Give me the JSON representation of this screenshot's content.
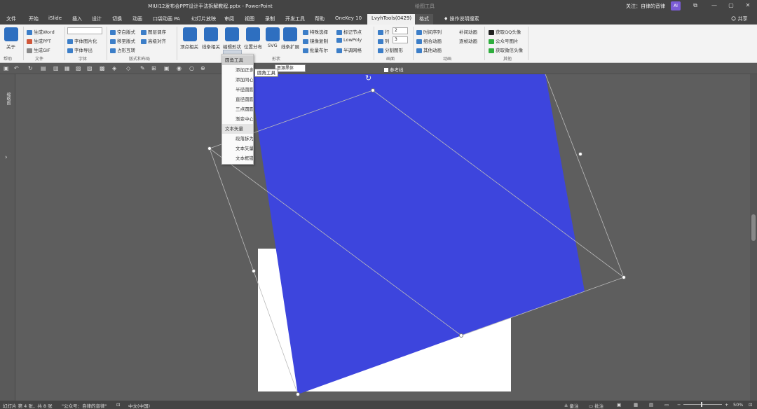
{
  "titlebar": {
    "document_title": "MIUI12发布会PPT设计手法拆解教程.pptx  -  PowerPoint",
    "tool_context": "绘图工具",
    "account": "关注：自律的音律",
    "avatar_text": "AI",
    "minimize_glyph": "—",
    "restore_glyph": "▢",
    "close_glyph": "✕",
    "ribbon_toggle_glyph": "⧉"
  },
  "tabs": [
    {
      "label": "文件"
    },
    {
      "label": "开始"
    },
    {
      "label": "iSlide"
    },
    {
      "label": "插入"
    },
    {
      "label": "设计"
    },
    {
      "label": "切换"
    },
    {
      "label": "动画"
    },
    {
      "label": "口袋动画 PA"
    },
    {
      "label": "幻灯片放映"
    },
    {
      "label": "审阅"
    },
    {
      "label": "视图"
    },
    {
      "label": "录制"
    },
    {
      "label": "开发工具"
    },
    {
      "label": "帮助"
    },
    {
      "label": "OneKey 10"
    },
    {
      "label": "LvyhTools(0429)"
    },
    {
      "label": "格式"
    }
  ],
  "tell_me": "操作说明搜索",
  "share": "共享",
  "ribbon": {
    "about": "关于",
    "help_group": "帮助",
    "file_group": "文件",
    "gen_word": "生成Word",
    "gen_ppt": "生成PPT",
    "gen_gif": "生成GIF",
    "font_group": "字体",
    "font_vector": "字体图片化",
    "font_export": "字体导出",
    "layout_group": "版式和布局",
    "blank_layout": "空白版式",
    "fill_layout": "移至版式",
    "occupy_text": "占形互转",
    "layer_adjust": "图层调序",
    "align_adjust": "高级对齐",
    "vertex_related": "顶点相关",
    "line_related": "线条相关",
    "edit_shape": "编辑形状",
    "position_distribute": "位置分布",
    "svg": "SVG",
    "line_expand": "线条扩展",
    "special_select": "特殊选择",
    "mirror_copy": "镜像复制",
    "batch_layout": "批量布尔",
    "mark_nodes": "标记节点",
    "lowpoly": "LowPoly",
    "half_grid": "半调网格",
    "row_label": "行",
    "row_value": "2",
    "col_label": "列",
    "col_value": "3",
    "split_shape": "分割图形",
    "canvas_group": "画面",
    "time_seq": "时间序列",
    "group_anim": "组合动画",
    "other_anim": "其他动画",
    "fill_anim": "补间动画",
    "smooth_anim": "逐帧动画",
    "anim_group": "动画",
    "get_qq": "获取QQ头像",
    "public_img": "公众号图片",
    "get_wechat": "获取微信头像",
    "other_group": "其他",
    "shape_group_label": "形状"
  },
  "qat": {
    "font_name": "思源黑体",
    "ref_line": "参考线"
  },
  "menu": {
    "items": [
      {
        "label": "圆角工具",
        "kind": "head"
      },
      {
        "label": "添加正多边形",
        "kind": "item"
      },
      {
        "label": "添加同心圆",
        "kind": "item"
      },
      {
        "label": "半径圆圆",
        "kind": "item"
      },
      {
        "label": "直径圆圆",
        "kind": "item"
      },
      {
        "label": "三点圆圆",
        "kind": "item"
      },
      {
        "label": "渐变中心工具",
        "kind": "item"
      },
      {
        "label": "文本矢量",
        "kind": "head"
      },
      {
        "label": "段落拆为单字",
        "kind": "item"
      },
      {
        "label": "文本矢量化",
        "kind": "item"
      },
      {
        "label": "文本框镂空",
        "kind": "item"
      }
    ]
  },
  "tooltip": "圆角工具",
  "left_pane_label": "缩略图",
  "status": {
    "slide_info": "幻灯片 第 4 张，共 8 张",
    "author": "\"公众号：自律的音律\"",
    "language": "中文(中国)",
    "notes": "备注",
    "comments": "批注",
    "zoom": "50%"
  },
  "colors": {
    "shape_fill": "#3d45dd",
    "slide_bg": "#ffffff",
    "canvas_bg": "#5e5e5e"
  }
}
